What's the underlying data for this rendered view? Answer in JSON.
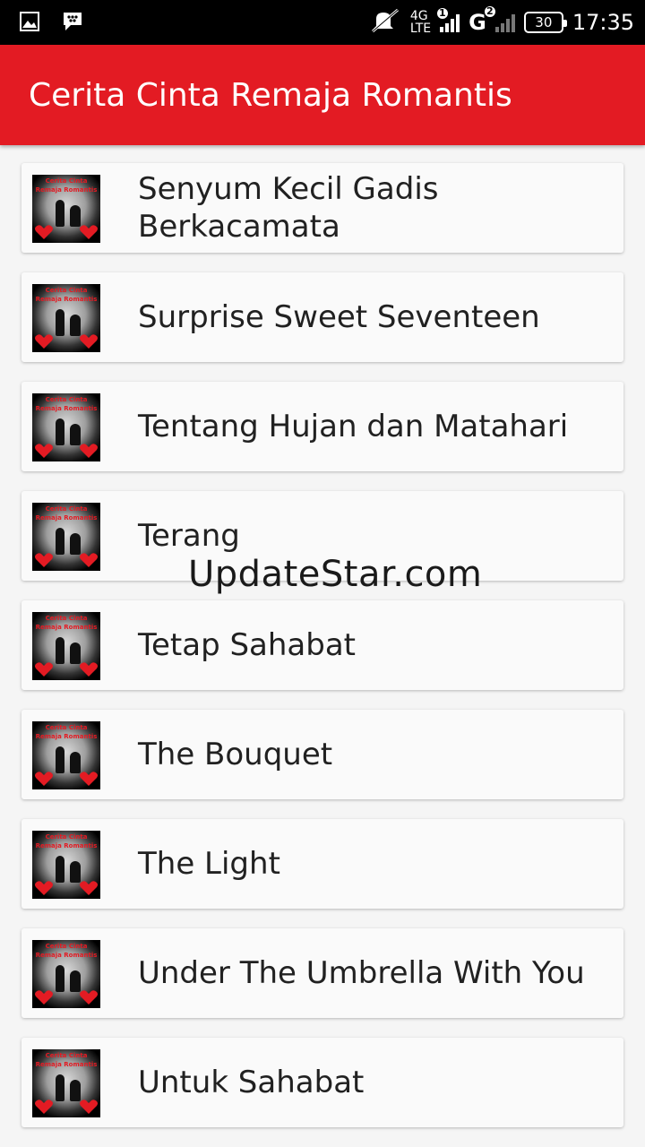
{
  "status_bar": {
    "network_type": "4G",
    "network_sub": "LTE",
    "sim1_badge": "1",
    "network2": "G",
    "sim2_badge": "2",
    "battery": "30",
    "time": "17:35",
    "icons": [
      "image-icon",
      "bbm-icon",
      "muted-notification-icon"
    ]
  },
  "app_bar": {
    "title": "Cerita Cinta Remaja Romantis"
  },
  "list": {
    "items": [
      {
        "label": "Senyum Kecil Gadis Berkacamata"
      },
      {
        "label": "Surprise Sweet Seventeen"
      },
      {
        "label": "Tentang Hujan dan Matahari"
      },
      {
        "label": "Terang"
      },
      {
        "label": "Tetap Sahabat"
      },
      {
        "label": "The Bouquet"
      },
      {
        "label": "The Light"
      },
      {
        "label": "Under The Umbrella With You"
      },
      {
        "label": "Untuk Sahabat"
      }
    ],
    "thumbnail_text": {
      "line1": "Cerita Cinta",
      "line2": "Remaja Romantis"
    }
  },
  "watermark": "UpdateStar.com",
  "colors": {
    "app_bar": "#e31b23",
    "background": "#f5f5f5",
    "card": "#fafafa",
    "text": "#212121"
  }
}
